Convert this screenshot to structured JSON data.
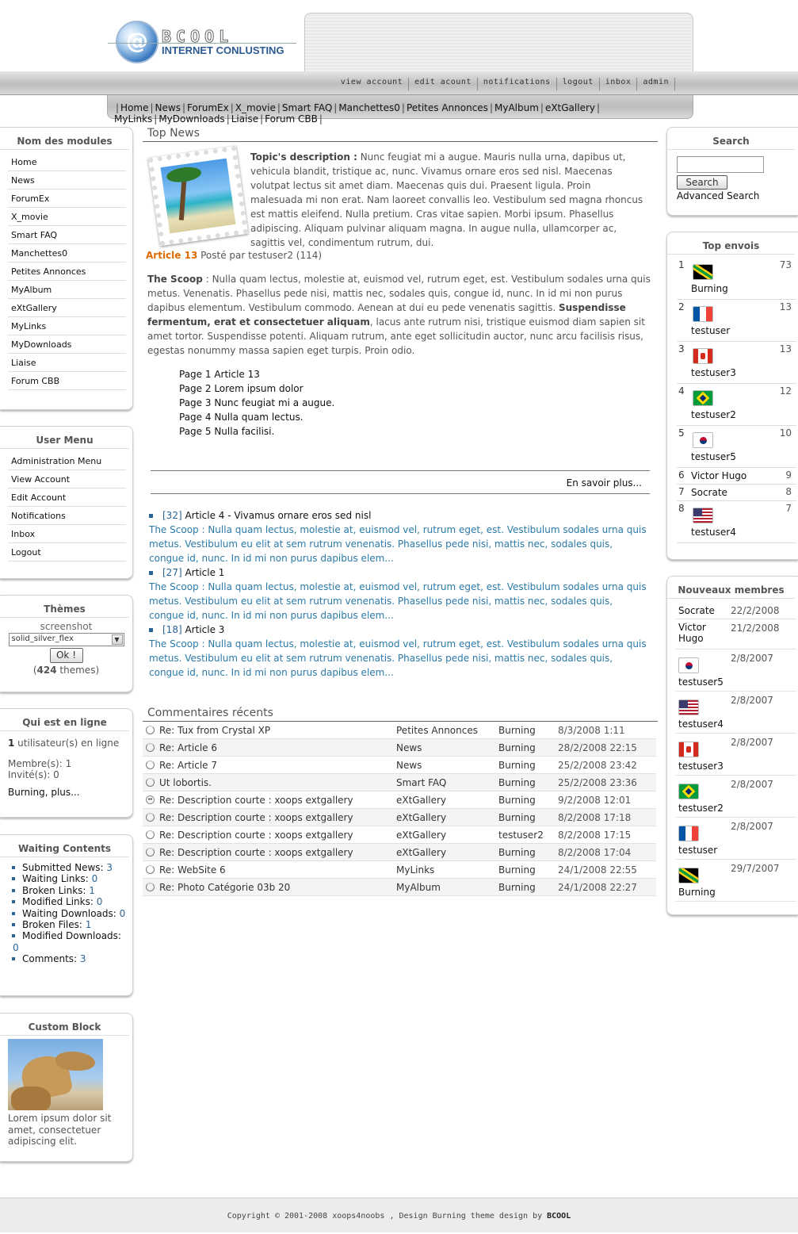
{
  "header": {
    "logo_word": "BCOOL",
    "logo_sub": "INTERNET CONLUSTING",
    "user_nav": [
      "view account",
      "edit acount",
      "notifications",
      "logout",
      "inbox",
      "admin"
    ]
  },
  "main_nav": [
    "Home",
    "News",
    "ForumEx",
    "X_movie",
    "Smart FAQ",
    "Manchettes0",
    "Petites Annonces",
    "MyAlbum",
    "eXtGallery",
    "MyLinks",
    "MyDownloads",
    "Liaise",
    "Forum CBB"
  ],
  "left": {
    "modules": {
      "title": "Nom des modules",
      "items": [
        "Home",
        "News",
        "ForumEx",
        "X_movie",
        "Smart FAQ",
        "Manchettes0",
        "Petites Annonces",
        "MyAlbum",
        "eXtGallery",
        "MyLinks",
        "MyDownloads",
        "Liaise",
        "Forum CBB"
      ]
    },
    "user_menu": {
      "title": "User Menu",
      "items": [
        "Administration Menu",
        "View Account",
        "Edit Account",
        "Notifications",
        "Inbox",
        "Logout"
      ]
    },
    "themes": {
      "title": "Thèmes",
      "screenshot_label": "screenshot",
      "selected": "solid_silver_flex",
      "ok_label": "Ok !",
      "count_prefix": "(",
      "count": "424",
      "count_suffix": " themes)"
    },
    "online": {
      "title": "Qui est en ligne",
      "users_count": "1",
      "users_text": " utilisateur(s) en ligne",
      "members": "Membre(s): 1",
      "guests": "Invité(s): 0",
      "list": "Burning, plus..."
    },
    "waiting": {
      "title": "Waiting Contents",
      "items": [
        {
          "label": "Submitted News:",
          "value": "3"
        },
        {
          "label": "Waiting Links:",
          "value": "0"
        },
        {
          "label": "Broken Links:",
          "value": "1"
        },
        {
          "label": "Modified Links:",
          "value": "0"
        },
        {
          "label": "Waiting Downloads:",
          "value": "0"
        },
        {
          "label": "Broken Files:",
          "value": "1"
        },
        {
          "label": "Modified Downloads:",
          "value": "0"
        },
        {
          "label": "Comments:",
          "value": "3"
        }
      ]
    },
    "custom": {
      "title": "Custom Block",
      "text": "Lorem ipsum dolor sit amet, consectetuer adipiscing elit."
    }
  },
  "center": {
    "top_news_title": "Top News",
    "topic_label": "Topic's description :",
    "topic_text": " Nunc feugiat mi a augue. Mauris nulla urna, dapibus ut, vehicula blandit, tristique ac, nunc. Vivamus ornare eros sed nisl. Maecenas volutpat lectus sit amet diam. Maecenas quis dui. Praesent ligula. Proin malesuada mi non erat. Nam laoreet convallis leo. Vestibulum sed magna rhoncus est mattis eleifend. Nulla pretium. Cras vitae sapien. Morbi ipsum. Phasellus adipiscing. Aliquam pulvinar aliquam magna. In augue nulla, ullamcorper ac, sagittis vel, condimentum rutrum, dui.",
    "article_title": "Article 13",
    "article_meta": " Posté par testuser2 (114)",
    "scoop_label": "The Scoop",
    "scoop_text_1": " : Nulla quam lectus, molestie at, euismod vel, rutrum eget, est. Vestibulum sodales urna quis metus. Venenatis. Phasellus pede nisi, mattis nec, sodales quis, congue id, nunc. In id mi non purus dapibus elementum. Vestibulum commodo. Aenean at dui eu pede venenatis sagittis. ",
    "scoop_bold": "Suspendisse fermentum, erat et consectetuer aliquam",
    "scoop_text_2": ", lacus ante rutrum nisi, tristique euismod diam sapien sit amet tortor. Suspendisse potenti. Aliquam rutrum, ante eget sollicitudin auctor, nunc arcu facilisis risus, egestas nonummy massa sapien eget turpis. Proin odio.",
    "pages": [
      "Page 1 Article 13",
      "Page 2 Lorem ipsum dolor",
      "Page 3 Nunc feugiat mi a augue.",
      "Page 4 Nulla quam lectus.",
      "Page 5 Nulla facilisi."
    ],
    "read_more": "En savoir plus...",
    "news_list": [
      {
        "id": "[32]",
        "title": " Article 4 - Vivamus ornare eros sed nisl",
        "excerpt": "The Scoop : Nulla quam lectus, molestie at, euismod vel, rutrum eget, est. Vestibulum sodales urna quis metus. Vestibulum eu elit at sem rutrum venenatis. Phasellus pede nisi, mattis nec, sodales quis, congue id, nunc. In id mi non purus dapibus elem..."
      },
      {
        "id": "[27]",
        "title": " Article 1",
        "excerpt": "The Scoop : Nulla quam lectus, molestie at, euismod vel, rutrum eget, est. Vestibulum sodales urna quis metus. Vestibulum eu elit at sem rutrum venenatis. Phasellus pede nisi, mattis nec, sodales quis, congue id, nunc. In id mi non purus dapibus elem..."
      },
      {
        "id": "[18]",
        "title": " Article 3",
        "excerpt": "The Scoop : Nulla quam lectus, molestie at, euismod vel, rutrum eget, est. Vestibulum sodales urna quis metus. Vestibulum eu elit at sem rutrum venenatis. Phasellus pede nisi, mattis nec, sodales quis, congue id, nunc. In id mi non purus dapibus elem..."
      }
    ],
    "comments_title": "Commentaires récents",
    "comments": [
      {
        "icon": "circle",
        "title": "Re: Tux from Crystal XP",
        "module": "Petites Annonces",
        "user": "Burning",
        "date": "8/3/2008 1:11"
      },
      {
        "icon": "circle",
        "title": "Re: Article 6",
        "module": "News",
        "user": "Burning",
        "date": "28/2/2008 22:15"
      },
      {
        "icon": "circle",
        "title": "Re: Article 7",
        "module": "News",
        "user": "Burning",
        "date": "25/2/2008 23:42"
      },
      {
        "icon": "circle",
        "title": "Ut lobortis.",
        "module": "Smart FAQ",
        "user": "Burning",
        "date": "25/2/2008 23:36"
      },
      {
        "icon": "smiley",
        "title": "Re: Description courte : xoops extgallery",
        "module": "eXtGallery",
        "user": "Burning",
        "date": "9/2/2008 12:01"
      },
      {
        "icon": "circle",
        "title": "Re: Description courte : xoops extgallery",
        "module": "eXtGallery",
        "user": "Burning",
        "date": "8/2/2008 17:18"
      },
      {
        "icon": "circle",
        "title": "Re: Description courte : xoops extgallery",
        "module": "eXtGallery",
        "user": "testuser2",
        "date": "8/2/2008 17:15"
      },
      {
        "icon": "circle",
        "title": "Re: Description courte : xoops extgallery",
        "module": "eXtGallery",
        "user": "Burning",
        "date": "8/2/2008 17:04"
      },
      {
        "icon": "circle",
        "title": "Re: WebSite 6",
        "module": "MyLinks",
        "user": "Burning",
        "date": "24/1/2008 22:55"
      },
      {
        "icon": "circle",
        "title": "Re: Photo Catégorie 03b 20",
        "module": "MyAlbum",
        "user": "Burning",
        "date": "24/1/2008 22:27"
      }
    ]
  },
  "right": {
    "search": {
      "title": "Search",
      "button": "Search",
      "advanced": "Advanced Search",
      "value": ""
    },
    "top_posters": {
      "title": "Top envois",
      "rows": [
        {
          "rank": "1",
          "flag": "jm",
          "name": "Burning",
          "count": "73"
        },
        {
          "rank": "2",
          "flag": "fr",
          "name": "testuser",
          "count": "13"
        },
        {
          "rank": "3",
          "flag": "ca",
          "name": "testuser3",
          "count": "13"
        },
        {
          "rank": "4",
          "flag": "br",
          "name": "testuser2",
          "count": "12"
        },
        {
          "rank": "5",
          "flag": "kr",
          "name": "testuser5",
          "count": "10"
        },
        {
          "rank": "6",
          "flag": "",
          "name": "Victor Hugo",
          "count": "9"
        },
        {
          "rank": "7",
          "flag": "",
          "name": "Socrate",
          "count": "8"
        },
        {
          "rank": "8",
          "flag": "us",
          "name": "testuser4",
          "count": "7"
        }
      ]
    },
    "new_members": {
      "title": "Nouveaux membres",
      "rows": [
        {
          "flag": "",
          "name": "Socrate",
          "date": "22/2/2008"
        },
        {
          "flag": "",
          "name": "Victor Hugo",
          "date": "21/2/2008"
        },
        {
          "flag": "kr",
          "name": "testuser5",
          "date": "2/8/2007"
        },
        {
          "flag": "us",
          "name": "testuser4",
          "date": "2/8/2007"
        },
        {
          "flag": "ca",
          "name": "testuser3",
          "date": "2/8/2007"
        },
        {
          "flag": "br",
          "name": "testuser2",
          "date": "2/8/2007"
        },
        {
          "flag": "fr",
          "name": "testuser",
          "date": "2/8/2007"
        },
        {
          "flag": "jm",
          "name": "Burning",
          "date": "29/7/2007"
        }
      ]
    }
  },
  "footer": {
    "text": "Copyright © 2001-2008 xoops4noobs , Design Burning theme design by ",
    "brand": "BCOOL"
  }
}
